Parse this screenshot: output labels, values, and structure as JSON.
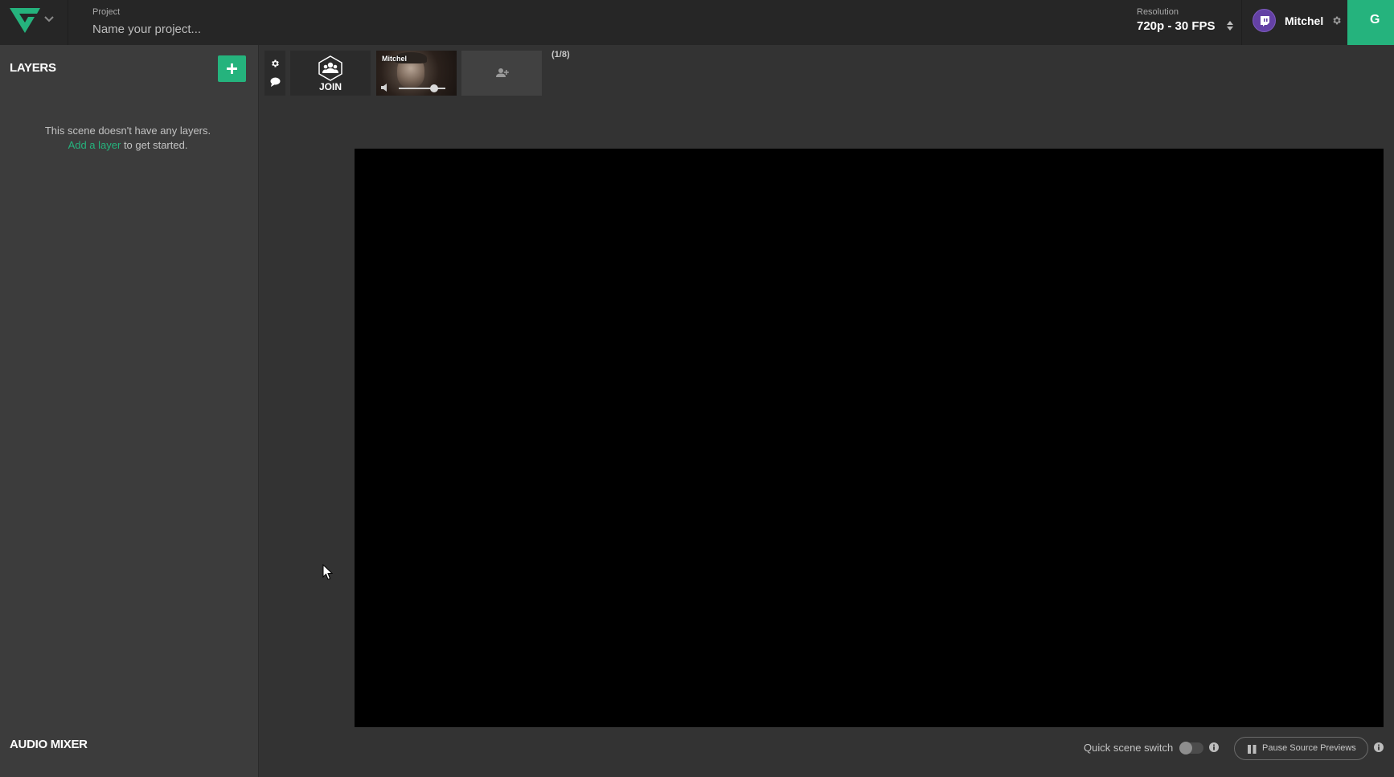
{
  "header": {
    "project_label": "Project",
    "project_placeholder": "Name your project...",
    "resolution_label": "Resolution",
    "resolution_value": "720p - 30 FPS",
    "account_name": "Mitchel",
    "go_live_label": "G"
  },
  "sidebar": {
    "layers_title": "LAYERS",
    "empty_line1": "This scene doesn't have any layers.",
    "empty_link": "Add a layer",
    "empty_line2": " to get started.",
    "audio_title": "AUDIO MIXER"
  },
  "guests": {
    "join_label": "JOIN",
    "camera_name": "Mitchel",
    "volume": 0.75,
    "count": "(1/8)"
  },
  "footer": {
    "quick_switch_label": "Quick scene switch",
    "quick_switch_on": false,
    "pause_label": "Pause Source Previews"
  },
  "colors": {
    "accent": "#25b37d",
    "twitch": "#6441a5",
    "topbar": "#262626",
    "sidebar": "#3c3c3c",
    "workspace": "#333333"
  },
  "icons": {
    "logo": "studio-logo-icon",
    "chevron": "chevron-down-icon",
    "sort": "sort-arrows-icon",
    "twitch": "twitch-icon",
    "gear": "gear-icon",
    "plus": "plus-icon",
    "chat": "chat-bubble-icon",
    "group": "group-users-icon",
    "mute": "speaker-mute-icon",
    "add_user": "add-user-icon",
    "info": "info-icon",
    "pause": "pause-icon"
  }
}
